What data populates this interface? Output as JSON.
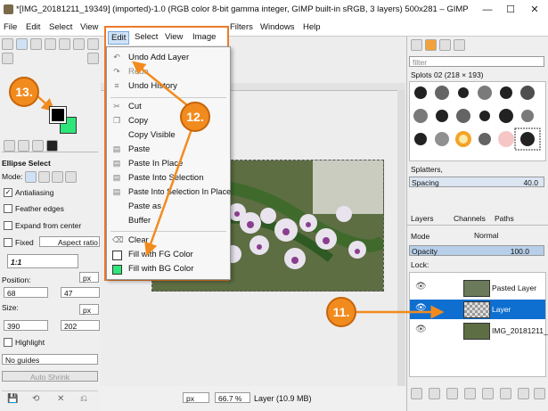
{
  "window": {
    "title": "*[IMG_20181211_19349] (imported)-1.0 (RGB color 8-bit gamma integer, GIMP built-in sRGB, 3 layers) 500x281 – GIMP",
    "controls": [
      "—",
      "☐",
      "✕"
    ]
  },
  "menubar": {
    "items": [
      "File",
      "Edit",
      "Select",
      "View",
      "Filters",
      "Windows",
      "Help"
    ]
  },
  "inner_menubar": {
    "items": [
      "Edit",
      "Select",
      "View",
      "Image"
    ]
  },
  "edit_menu": {
    "items": [
      {
        "label": "Undo Add Layer",
        "icon": "undo-icon",
        "enabled": true
      },
      {
        "label": "Redo",
        "icon": "redo-icon",
        "enabled": false
      },
      {
        "label": "Undo History",
        "icon": "history-icon",
        "enabled": true
      },
      {
        "label": "Cut",
        "icon": "cut-icon",
        "enabled": true
      },
      {
        "label": "Copy",
        "icon": "copy-icon",
        "enabled": true
      },
      {
        "label": "Copy Visible",
        "icon": "",
        "enabled": true
      },
      {
        "label": "Paste",
        "icon": "paste-icon",
        "enabled": true
      },
      {
        "label": "Paste In Place",
        "icon": "paste-icon",
        "enabled": true
      },
      {
        "label": "Paste Into Selection",
        "icon": "paste-icon",
        "enabled": true
      },
      {
        "label": "Paste Into Selection In Place",
        "icon": "paste-icon",
        "enabled": true
      },
      {
        "label": "Paste as",
        "icon": "",
        "enabled": true
      },
      {
        "label": "Buffer",
        "icon": "",
        "enabled": true
      },
      {
        "label": "Clear",
        "icon": "clear-icon",
        "enabled": true
      },
      {
        "label": "Fill with FG Color",
        "icon": "fg-swatch-icon",
        "enabled": true
      },
      {
        "label": "Fill with BG Color",
        "icon": "bg-swatch-icon",
        "enabled": true
      }
    ]
  },
  "toolbox": {
    "tool_options_title": "Ellipse Select",
    "mode_label": "Mode:",
    "antialiasing": {
      "label": "Antialiasing",
      "checked": true
    },
    "feather_edges": {
      "label": "Feather edges",
      "checked": false
    },
    "expand_from_center": {
      "label": "Expand from center",
      "checked": false
    },
    "fixed": {
      "label": "Fixed",
      "value": "Aspect ratio"
    },
    "ratio": "1:1",
    "position": {
      "label": "Position:",
      "x": "68",
      "y": "47",
      "unit": "px"
    },
    "size": {
      "label": "Size:",
      "w": "390",
      "h": "202",
      "unit": "px"
    },
    "highlight": {
      "label": "Highlight",
      "checked": false
    },
    "guides": "No guides",
    "auto_shrink": "Auto Shrink",
    "fg_color": "#000000",
    "bg_color": "#2ee57a"
  },
  "status": {
    "unit": "px",
    "zoom": "66.7 %",
    "info": "Layer (10.9 MB)"
  },
  "dock": {
    "filter_placeholder": "filter",
    "brush_name": "Splots 02 (218 × 193)",
    "brush_tag": "Splatters,",
    "spacing_label": "Spacing",
    "spacing_value": "40.0",
    "tabs": [
      "Layers",
      "Channels",
      "Paths"
    ],
    "mode_label": "Mode",
    "mode_value": "Normal",
    "opacity_label": "Opacity",
    "opacity_value": "100.0",
    "lock_label": "Lock:",
    "layers": [
      {
        "name": "Pasted Layer",
        "selected": false
      },
      {
        "name": "Layer",
        "selected": true
      },
      {
        "name": "IMG_20181211_",
        "selected": false
      }
    ]
  },
  "annotations": {
    "steps": [
      "13.",
      "12.",
      "11."
    ],
    "color": "#f28b1e"
  }
}
